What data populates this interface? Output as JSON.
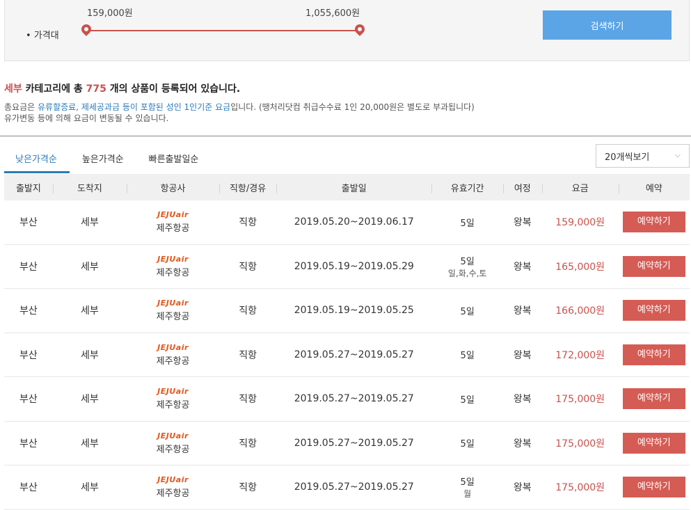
{
  "filter": {
    "price_label": "• 가격대",
    "price_min": "159,000원",
    "price_max": "1,055,600원",
    "search_label": "검색하기"
  },
  "summary": {
    "region": "세부",
    "text1": " 카테고리에 총 ",
    "count": "775",
    "text2": " 개의 상품이 등록되어 있습니다.",
    "sub1_pre": "총요금은 ",
    "sub1_blue": "유류할증료, 제세공과금 등이 포함된 성인 1인기준 요금",
    "sub1_post": "입니다. (땡처리닷컴 취급수수료 1인 20,000원은 별도로 부과됩니다)",
    "sub2": "유가변동 등에 의해 요금이 변동될 수 있습니다."
  },
  "tabs": [
    "낮은가격순",
    "높은가격순",
    "빠른출발일순"
  ],
  "view_select": "20개씩보기",
  "colors": {
    "accent_red": "#c9514d",
    "accent_blue": "#2a7ab8",
    "search_btn": "#5ba4e5"
  },
  "table": {
    "headers": [
      "출발지",
      "도착지",
      "항공사",
      "직항/경유",
      "출발일",
      "유효기간",
      "여정",
      "요금",
      "예약"
    ],
    "rows": [
      {
        "from": "부산",
        "to": "세부",
        "airline_logo": "JEJUair",
        "airline": "제주항공",
        "type": "직항",
        "dates": "2019.05.20~2019.06.17",
        "valid": "5일",
        "valid_sub": "",
        "trip": "왕복",
        "price": "159,000원",
        "book": "예약하기"
      },
      {
        "from": "부산",
        "to": "세부",
        "airline_logo": "JEJUair",
        "airline": "제주항공",
        "type": "직항",
        "dates": "2019.05.19~2019.05.29",
        "valid": "5일",
        "valid_sub": "일,화,수,토",
        "trip": "왕복",
        "price": "165,000원",
        "book": "예약하기"
      },
      {
        "from": "부산",
        "to": "세부",
        "airline_logo": "JEJUair",
        "airline": "제주항공",
        "type": "직항",
        "dates": "2019.05.19~2019.05.25",
        "valid": "5일",
        "valid_sub": "",
        "trip": "왕복",
        "price": "166,000원",
        "book": "예약하기"
      },
      {
        "from": "부산",
        "to": "세부",
        "airline_logo": "JEJUair",
        "airline": "제주항공",
        "type": "직항",
        "dates": "2019.05.27~2019.05.27",
        "valid": "5일",
        "valid_sub": "",
        "trip": "왕복",
        "price": "172,000원",
        "book": "예약하기"
      },
      {
        "from": "부산",
        "to": "세부",
        "airline_logo": "JEJUair",
        "airline": "제주항공",
        "type": "직항",
        "dates": "2019.05.27~2019.05.27",
        "valid": "5일",
        "valid_sub": "",
        "trip": "왕복",
        "price": "175,000원",
        "book": "예약하기"
      },
      {
        "from": "부산",
        "to": "세부",
        "airline_logo": "JEJUair",
        "airline": "제주항공",
        "type": "직항",
        "dates": "2019.05.27~2019.05.27",
        "valid": "5일",
        "valid_sub": "",
        "trip": "왕복",
        "price": "175,000원",
        "book": "예약하기"
      },
      {
        "from": "부산",
        "to": "세부",
        "airline_logo": "JEJUair",
        "airline": "제주항공",
        "type": "직항",
        "dates": "2019.05.27~2019.05.27",
        "valid": "5일",
        "valid_sub": "월",
        "trip": "왕복",
        "price": "175,000원",
        "book": "예약하기"
      }
    ]
  }
}
